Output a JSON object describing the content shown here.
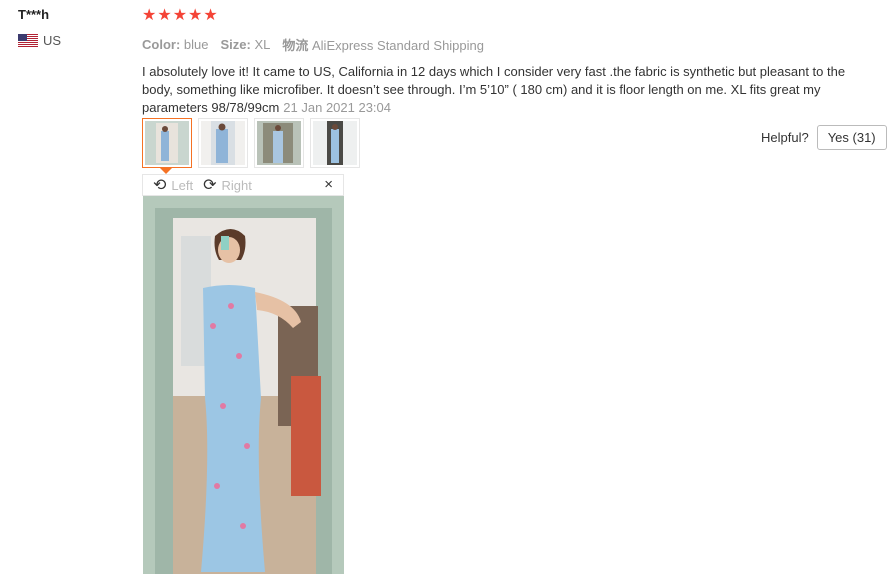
{
  "user": {
    "name": "T***h",
    "country": "US"
  },
  "rating": {
    "stars": 5
  },
  "meta": {
    "color_label": "Color:",
    "color_value": "blue",
    "size_label": "Size:",
    "size_value": "XL",
    "shipping_label": "物流",
    "shipping_value": "AliExpress Standard Shipping"
  },
  "review": {
    "text": "I absolutely love it! It came to US, California in 12 days which I consider very fast .the fabric is synthetic but pleasant to the body, something like microfiber. It doesn’t see through. I’m 5’10” ( 180 cm) and it is floor length on me. XL fits great my parameters 98/78/99cm",
    "date": "21 Jan 2021 23:04"
  },
  "viewer": {
    "left_label": "Left",
    "right_label": "Right",
    "close_icon": "×"
  },
  "helpful": {
    "label": "Helpful?",
    "yes_label": "Yes (31)"
  },
  "colors": {
    "accent": "#f57224",
    "star": "#f44336"
  },
  "icons": [
    "rotate-left-icon",
    "rotate-right-icon",
    "close-icon",
    "us-flag-icon",
    "star-icon"
  ]
}
